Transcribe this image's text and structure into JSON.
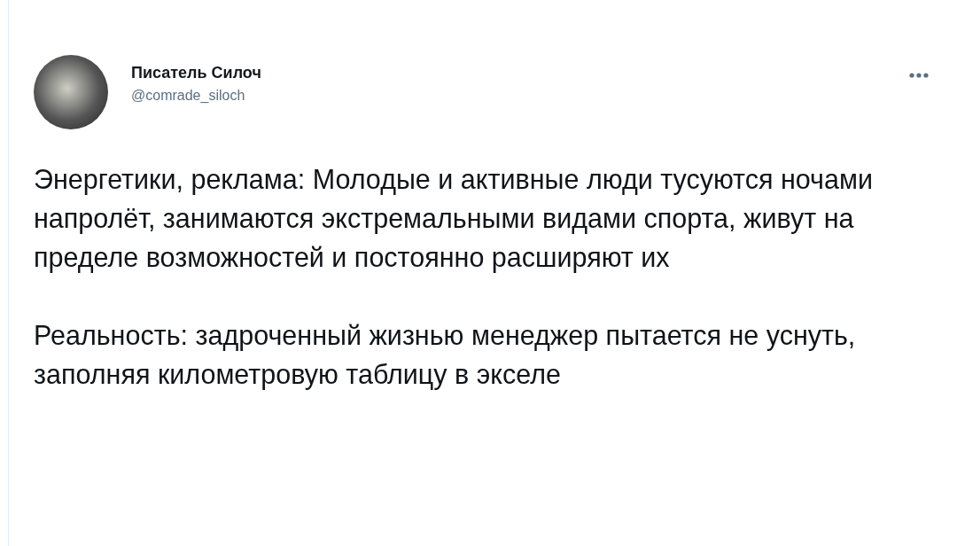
{
  "tweet": {
    "author": {
      "name": "Писатель Силоч",
      "handle": "@comrade_siloch"
    },
    "paragraphs": [
      "Энергетики, реклама: Молодые и активные люди тусуются ночами напролёт, занимаются экстремальными видами спорта, живут на пределе возможностей и постоянно расширяют их",
      "Реальность: задроченный жизнью менеджер пытается не уснуть, заполняя километровую таблицу в экселе"
    ]
  }
}
